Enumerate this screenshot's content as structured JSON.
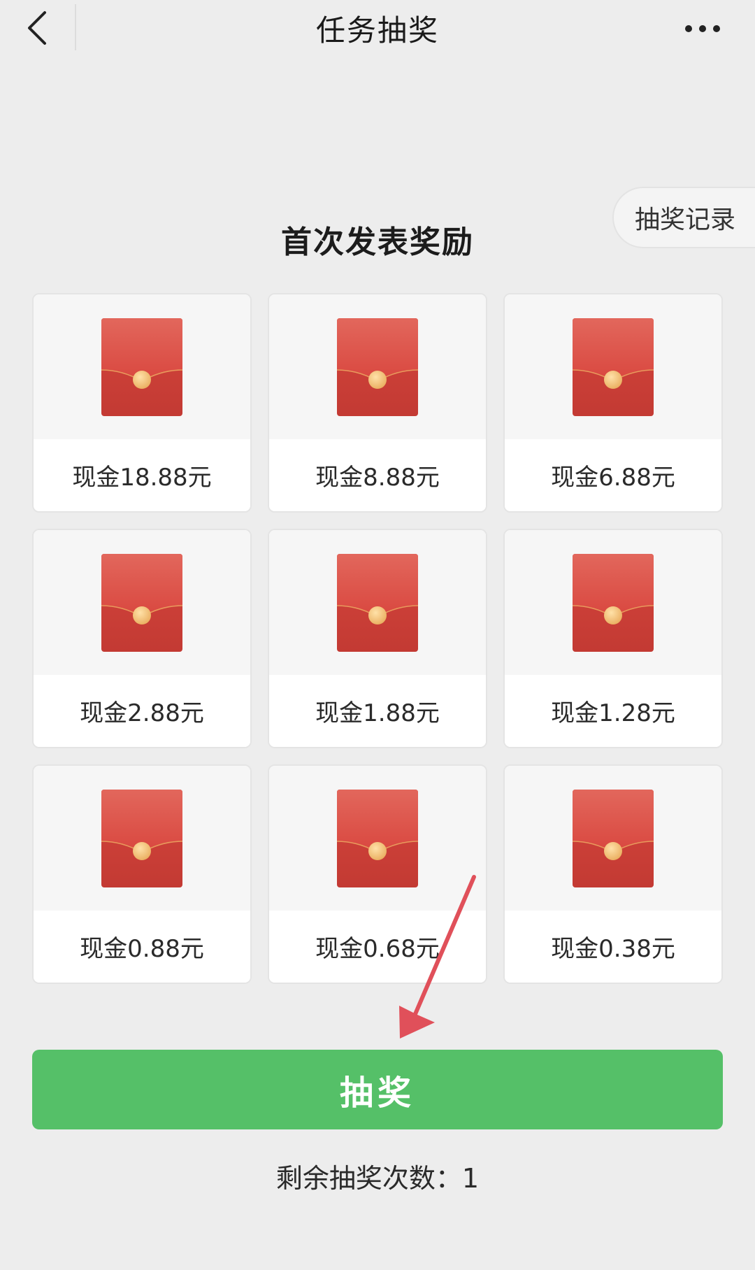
{
  "navbar": {
    "title": "任务抽奖",
    "back_icon": "chevron-left-icon",
    "more_icon": "more-dots-icon"
  },
  "record_button": {
    "label": "抽奖记录"
  },
  "section_title": "首次发表奖励",
  "prizes": [
    {
      "label": "现金18.88元",
      "icon": "red-envelope-icon"
    },
    {
      "label": "现金8.88元",
      "icon": "red-envelope-icon"
    },
    {
      "label": "现金6.88元",
      "icon": "red-envelope-icon"
    },
    {
      "label": "现金2.88元",
      "icon": "red-envelope-icon"
    },
    {
      "label": "现金1.88元",
      "icon": "red-envelope-icon"
    },
    {
      "label": "现金1.28元",
      "icon": "red-envelope-icon"
    },
    {
      "label": "现金0.88元",
      "icon": "red-envelope-icon"
    },
    {
      "label": "现金0.68元",
      "icon": "red-envelope-icon"
    },
    {
      "label": "现金0.38元",
      "icon": "red-envelope-icon"
    }
  ],
  "draw_button": {
    "label": "抽奖"
  },
  "remaining": {
    "text": "剩余抽奖次数：1"
  },
  "colors": {
    "background": "#ededed",
    "draw_button": "#55c068",
    "envelope": "#d9473f",
    "seal": "#f0c07a",
    "annotation_arrow": "#e0505a"
  }
}
